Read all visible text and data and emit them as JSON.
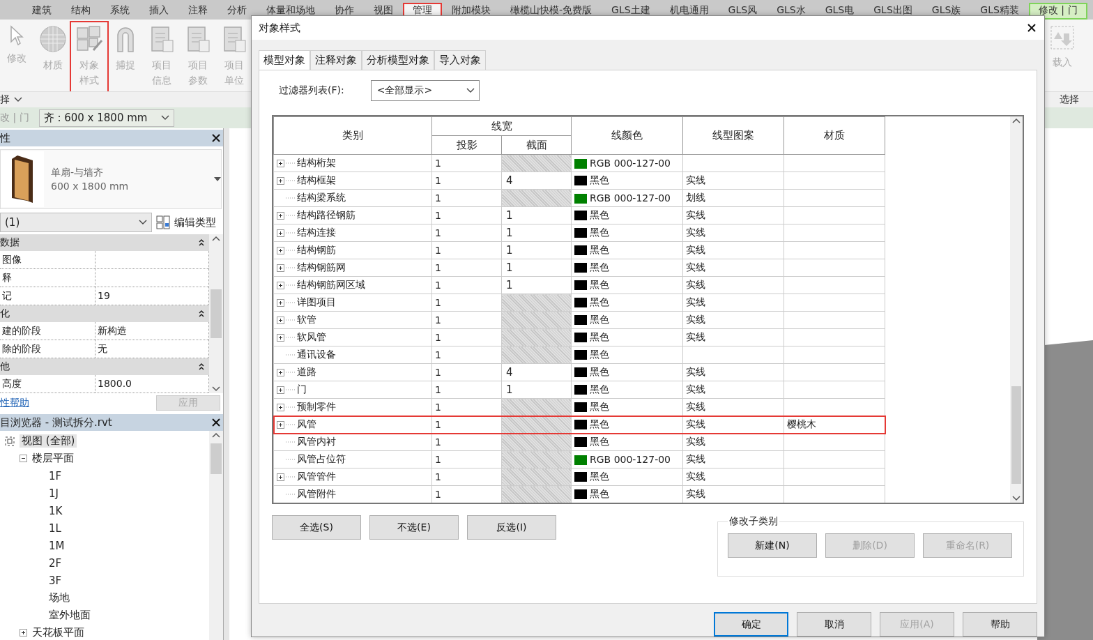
{
  "ribbon": {
    "tabs": [
      {
        "label": "建筑",
        "kind": "normal",
        "selected": false,
        "highlighted": false
      },
      {
        "label": "结构",
        "kind": "normal",
        "selected": false,
        "highlighted": false
      },
      {
        "label": "系统",
        "kind": "normal",
        "selected": false,
        "highlighted": false
      },
      {
        "label": "插入",
        "kind": "normal",
        "selected": false,
        "highlighted": false
      },
      {
        "label": "注释",
        "kind": "normal",
        "selected": false,
        "highlighted": false
      },
      {
        "label": "分析",
        "kind": "normal",
        "selected": false,
        "highlighted": false
      },
      {
        "label": "体量和场地",
        "kind": "normal",
        "selected": false,
        "highlighted": false
      },
      {
        "label": "协作",
        "kind": "normal",
        "selected": false,
        "highlighted": false
      },
      {
        "label": "视图",
        "kind": "normal",
        "selected": false,
        "highlighted": false
      },
      {
        "label": "管理",
        "kind": "normal",
        "selected": true,
        "highlighted": true
      },
      {
        "label": "附加模块",
        "kind": "normal",
        "selected": false,
        "highlighted": false
      },
      {
        "label": "橄榄山快模-免费版",
        "kind": "normal",
        "selected": false,
        "highlighted": false
      },
      {
        "label": "GLS土建",
        "kind": "normal",
        "selected": false,
        "highlighted": false
      },
      {
        "label": "机电通用",
        "kind": "normal",
        "selected": false,
        "highlighted": false
      },
      {
        "label": "GLS风",
        "kind": "normal",
        "selected": false,
        "highlighted": false
      },
      {
        "label": "GLS水",
        "kind": "normal",
        "selected": false,
        "highlighted": false
      },
      {
        "label": "GLS电",
        "kind": "normal",
        "selected": false,
        "highlighted": false
      },
      {
        "label": "GLS出图",
        "kind": "normal",
        "selected": false,
        "highlighted": false
      },
      {
        "label": "GLS族",
        "kind": "normal",
        "selected": false,
        "highlighted": false
      },
      {
        "label": "GLS精装",
        "kind": "normal",
        "selected": false,
        "highlighted": false
      },
      {
        "label": "修改 | 门",
        "kind": "contextual",
        "selected": false,
        "highlighted": false
      }
    ],
    "tools": [
      {
        "label": "修改",
        "highlighted": false
      },
      {
        "label": "材质",
        "highlighted": false
      },
      {
        "label": "对象样式",
        "highlighted": true
      },
      {
        "label": "捕捉",
        "highlighted": false
      },
      {
        "label": "项目信息",
        "highlighted": false
      },
      {
        "label": "项目参数",
        "highlighted": false
      },
      {
        "label": "项目单位",
        "highlighted": false
      }
    ],
    "right_tool": "载入",
    "left_panel_label": "择",
    "right_panel_label": "选择"
  },
  "context_bar": {
    "label": "改 | 门",
    "type_selector": "齐 : 600 x 1800 mm"
  },
  "properties": {
    "title": "性",
    "type_name": "单扇-与墙齐",
    "type_size": "600 x 1800 mm",
    "instance_filter": "(1)",
    "edit_type": "编辑类型",
    "groups": [
      {
        "title": "数据",
        "rows": [
          {
            "name": "图像",
            "value": ""
          },
          {
            "name": "释",
            "value": ""
          },
          {
            "name": "记",
            "value": "19"
          }
        ]
      },
      {
        "title": "化",
        "rows": [
          {
            "name": "建的阶段",
            "value": "新构造"
          },
          {
            "name": "除的阶段",
            "value": "无"
          }
        ]
      },
      {
        "title": "他",
        "rows": [
          {
            "name": "高度",
            "value": "1800.0"
          }
        ]
      }
    ],
    "help_link": "性帮助",
    "apply": {
      "label": "应用",
      "disabled": true
    }
  },
  "browser": {
    "title": "目浏览器 - 测试拆分.rvt",
    "tree": [
      {
        "label": "视图 (全部)",
        "selected": true,
        "children": [
          {
            "label": "楼层平面",
            "selected": false,
            "expanded": true,
            "children": [
              {
                "label": "1F",
                "selected": false
              },
              {
                "label": "1J",
                "selected": false
              },
              {
                "label": "1K",
                "selected": false
              },
              {
                "label": "1L",
                "selected": false
              },
              {
                "label": "1M",
                "selected": false
              },
              {
                "label": "2F",
                "selected": false
              },
              {
                "label": "3F",
                "selected": false
              },
              {
                "label": "场地",
                "selected": false
              },
              {
                "label": "室外地面",
                "selected": false
              }
            ]
          },
          {
            "label": "天花板平面",
            "selected": false,
            "expanded": false
          }
        ]
      }
    ]
  },
  "dialog": {
    "title": "对象样式",
    "tabs": [
      {
        "label": "模型对象",
        "selected": true
      },
      {
        "label": "注释对象",
        "selected": false
      },
      {
        "label": "分析模型对象",
        "selected": false
      },
      {
        "label": "导入对象",
        "selected": false
      }
    ],
    "filter_label": "过滤器列表(F):",
    "filter_value": "<全部显示>",
    "columns": {
      "category": "类别",
      "line_weight": "线宽",
      "projection": "投影",
      "cut": "截面",
      "line_color": "线颜色",
      "line_pattern": "线型图案",
      "material": "材质"
    },
    "rows": [
      {
        "category": "结构桁架",
        "expandable": true,
        "projection": "1",
        "cut": "",
        "color": "#008000",
        "color_name": "RGB 000-127-00",
        "pattern": "",
        "material": "",
        "highlighted": false
      },
      {
        "category": "结构框架",
        "expandable": true,
        "projection": "1",
        "cut": "4",
        "color": "#000000",
        "color_name": "黑色",
        "pattern": "实线",
        "material": "",
        "highlighted": false
      },
      {
        "category": "结构梁系统",
        "expandable": false,
        "projection": "1",
        "cut": "",
        "color": "#008000",
        "color_name": "RGB 000-127-00",
        "pattern": "划线",
        "material": "",
        "highlighted": false
      },
      {
        "category": "结构路径钢筋",
        "expandable": true,
        "projection": "1",
        "cut": "1",
        "color": "#000000",
        "color_name": "黑色",
        "pattern": "实线",
        "material": "",
        "highlighted": false
      },
      {
        "category": "结构连接",
        "expandable": true,
        "projection": "1",
        "cut": "1",
        "color": "#000000",
        "color_name": "黑色",
        "pattern": "实线",
        "material": "",
        "highlighted": false
      },
      {
        "category": "结构钢筋",
        "expandable": true,
        "projection": "1",
        "cut": "1",
        "color": "#000000",
        "color_name": "黑色",
        "pattern": "实线",
        "material": "",
        "highlighted": false
      },
      {
        "category": "结构钢筋网",
        "expandable": true,
        "projection": "1",
        "cut": "1",
        "color": "#000000",
        "color_name": "黑色",
        "pattern": "实线",
        "material": "",
        "highlighted": false
      },
      {
        "category": "结构钢筋网区域",
        "expandable": true,
        "projection": "1",
        "cut": "1",
        "color": "#000000",
        "color_name": "黑色",
        "pattern": "实线",
        "material": "",
        "highlighted": false
      },
      {
        "category": "详图项目",
        "expandable": true,
        "projection": "1",
        "cut": "",
        "color": "#000000",
        "color_name": "黑色",
        "pattern": "实线",
        "material": "",
        "highlighted": false
      },
      {
        "category": "软管",
        "expandable": true,
        "projection": "1",
        "cut": "",
        "color": "#000000",
        "color_name": "黑色",
        "pattern": "实线",
        "material": "",
        "highlighted": false
      },
      {
        "category": "软风管",
        "expandable": true,
        "projection": "1",
        "cut": "",
        "color": "#000000",
        "color_name": "黑色",
        "pattern": "实线",
        "material": "",
        "highlighted": false
      },
      {
        "category": "通讯设备",
        "expandable": false,
        "projection": "1",
        "cut": "",
        "color": "#000000",
        "color_name": "黑色",
        "pattern": "",
        "material": "",
        "highlighted": false
      },
      {
        "category": "道路",
        "expandable": true,
        "projection": "1",
        "cut": "4",
        "color": "#000000",
        "color_name": "黑色",
        "pattern": "实线",
        "material": "",
        "highlighted": false
      },
      {
        "category": "门",
        "expandable": true,
        "projection": "1",
        "cut": "1",
        "color": "#000000",
        "color_name": "黑色",
        "pattern": "实线",
        "material": "",
        "highlighted": false
      },
      {
        "category": "预制零件",
        "expandable": true,
        "projection": "1",
        "cut": "",
        "color": "#000000",
        "color_name": "黑色",
        "pattern": "实线",
        "material": "",
        "highlighted": false
      },
      {
        "category": "风管",
        "expandable": true,
        "projection": "1",
        "cut": "",
        "color": "#000000",
        "color_name": "黑色",
        "pattern": "实线",
        "material": "樱桃木",
        "highlighted": true
      },
      {
        "category": "风管内衬",
        "expandable": false,
        "projection": "1",
        "cut": "",
        "color": "#000000",
        "color_name": "黑色",
        "pattern": "实线",
        "material": "",
        "highlighted": false
      },
      {
        "category": "风管占位符",
        "expandable": false,
        "projection": "1",
        "cut": "",
        "color": "#008000",
        "color_name": "RGB 000-127-00",
        "pattern": "实线",
        "material": "",
        "highlighted": false
      },
      {
        "category": "风管管件",
        "expandable": true,
        "projection": "1",
        "cut": "",
        "color": "#000000",
        "color_name": "黑色",
        "pattern": "实线",
        "material": "",
        "highlighted": false
      },
      {
        "category": "风管附件",
        "expandable": false,
        "projection": "1",
        "cut": "",
        "color": "#000000",
        "color_name": "黑色",
        "pattern": "实线",
        "material": "",
        "highlighted": false
      }
    ],
    "select_buttons": [
      "全选(S)",
      "不选(E)",
      "反选(I)"
    ],
    "subcategory": {
      "title": "修改子类别",
      "buttons": [
        {
          "label": "新建(N)",
          "disabled": false
        },
        {
          "label": "删除(D)",
          "disabled": true
        },
        {
          "label": "重命名(R)",
          "disabled": true
        }
      ]
    },
    "footer_buttons": [
      {
        "label": "确定",
        "default": true,
        "disabled": false
      },
      {
        "label": "取消",
        "default": false,
        "disabled": false
      },
      {
        "label": "应用(A)",
        "default": false,
        "disabled": true
      },
      {
        "label": "帮助",
        "default": false,
        "disabled": false
      }
    ]
  }
}
